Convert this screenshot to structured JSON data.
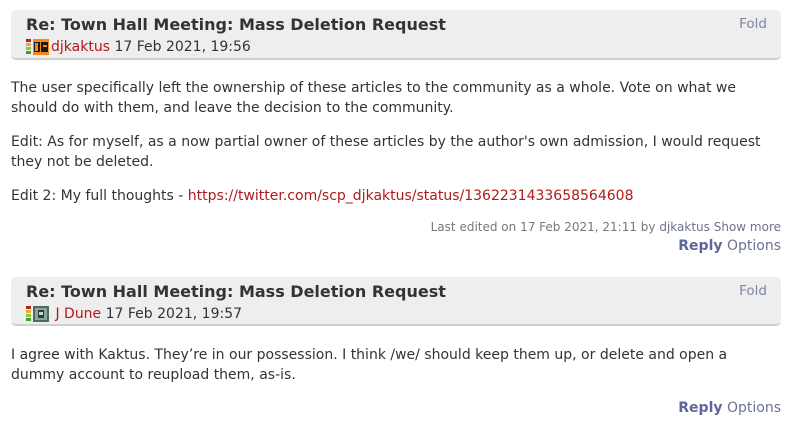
{
  "posts": [
    {
      "title": "Re: Town Hall Meeting: Mass Deletion Request",
      "fold_label": "Fold",
      "author": "djkaktus",
      "timestamp": "17 Feb 2021, 19:56",
      "paragraphs": [
        "The user specifically left the ownership of these articles to the community as a whole. Vote on what we should do with them, and leave the decision to the community.",
        "Edit: As for myself, as a now partial owner of these articles by the author's own admission, I would request they not be deleted."
      ],
      "edit2_prefix": "Edit 2: My full thoughts - ",
      "edit2_link": "https://twitter.com/scp_djkaktus/status/1362231433658564608",
      "edited_text": "Last edited on 17 Feb 2021, 21:11 by",
      "edited_by": "djkaktus",
      "show_more": "Show more",
      "reply_label": "Reply",
      "options_label": "Options"
    },
    {
      "title": "Re: Town Hall Meeting: Mass Deletion Request",
      "fold_label": "Fold",
      "author": "J Dune",
      "timestamp": "17 Feb 2021, 19:57",
      "paragraphs": [
        "I agree with Kaktus. They’re in our possession. I think /we/ should keep them up, or delete and open a dummy account to reupload them, as-is."
      ],
      "reply_label": "Reply",
      "options_label": "Options"
    }
  ],
  "colors": {
    "header_bg": "#eeeeee",
    "user_link": "#b01919",
    "action_link": "#5f6699",
    "karma_levels": [
      "#2aa53a",
      "#9cc234",
      "#e0b020",
      "#d06020",
      "#c02020"
    ]
  },
  "icons": {
    "karma": "karma-level-icon",
    "avatar": "user-avatar-icon"
  }
}
